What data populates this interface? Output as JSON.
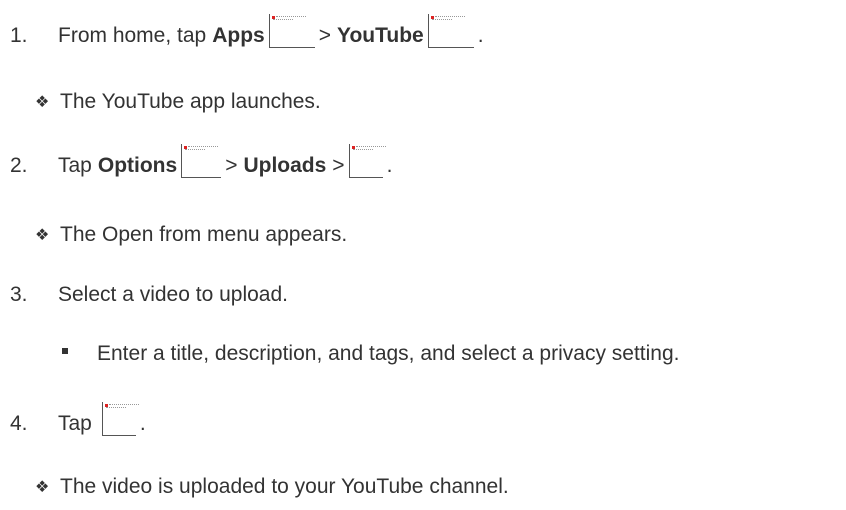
{
  "steps": [
    {
      "number": "1.",
      "text_before": "From home, tap",
      "bold1": "Apps",
      "sep": ">",
      "bold2": "YouTube",
      "end": ".",
      "icon1": "apps-icon",
      "icon2": "youtube-icon"
    },
    {
      "number": "2.",
      "text_before": "Tap",
      "bold1": "Options",
      "sep1": ">",
      "bold2": "Uploads",
      "sep2": ">",
      "end": ".",
      "icon1": "options-icon",
      "icon2": "add-upload-icon"
    },
    {
      "number": "3.",
      "text": "Select a video to upload."
    },
    {
      "number": "4.",
      "text_before": "Tap",
      "end": ".",
      "icon1": "upload-icon"
    }
  ],
  "results": {
    "r1": "The YouTube app launches.",
    "r2": "The Open from menu appears.",
    "r3": "Enter a title, description, and tags, and select a privacy setting.",
    "r4": "The video is uploaded to your YouTube channel."
  },
  "bullets": {
    "diamond": "❖"
  }
}
